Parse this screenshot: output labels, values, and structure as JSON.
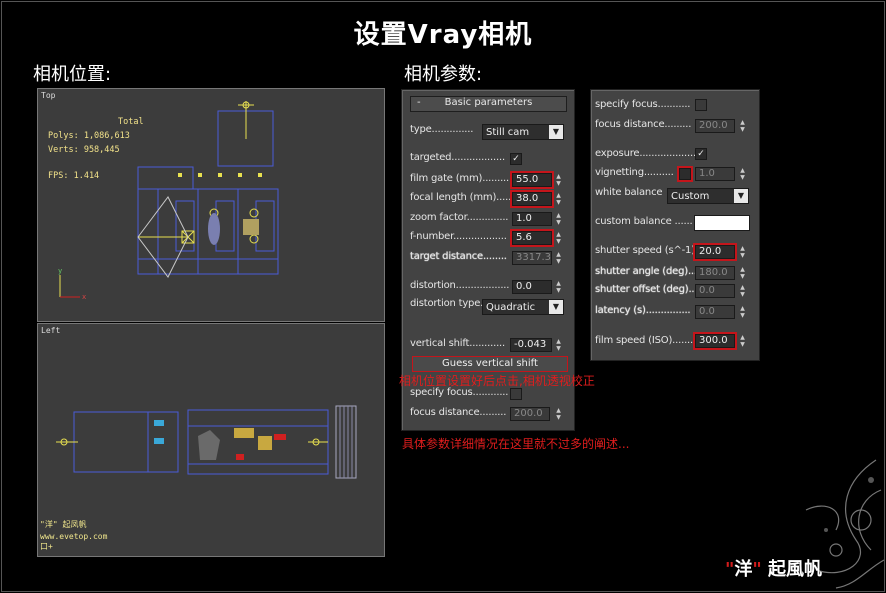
{
  "main_title": "设置Vray相机",
  "section_camera_position": "相机位置:",
  "section_camera_params": "相机参数:",
  "viewport_top": {
    "label": "Top",
    "stats": {
      "total": "Total",
      "polys": "Polys: 1,086,613",
      "verts": "Verts: 958,445",
      "fps": "FPS:  1.414"
    }
  },
  "viewport_left": {
    "label": "Left",
    "watermark_line1": "\"洋\" 起凤帆",
    "watermark_line2": "www.evetop.com",
    "watermark_line3": "口+"
  },
  "panel_basic": {
    "rollout_minus": "-",
    "rollout_title": "Basic parameters",
    "type_label": "type..............",
    "type_value": "Still cam",
    "targeted_label": "targeted..................",
    "targeted_check": "✓",
    "film_gate_label": "film gate (mm)...........",
    "film_gate_value": "55.0",
    "focal_length_label": "focal length (mm).....",
    "focal_length_value": "38.0",
    "zoom_factor_label": "zoom factor..............",
    "zoom_factor_value": "1.0",
    "f_number_label": "f-number..................",
    "f_number_value": "5.6",
    "target_distance_label": "target distance........",
    "target_distance_value": "3317.3",
    "distortion_label": "distortion..................",
    "distortion_value": "0.0",
    "distortion_type_label": "distortion type.",
    "distortion_type_value": "Quadratic",
    "vertical_shift_label": "vertical shift............",
    "vertical_shift_value": "-0.043",
    "guess_button": "Guess vertical shift",
    "specify_focus_label": "specify focus............",
    "focus_distance_label": "focus distance.........",
    "focus_distance_value": "200.0"
  },
  "panel_extra": {
    "specify_focus_label": "specify focus...........",
    "focus_distance_label": "focus distance.........",
    "focus_distance_value": "200.0",
    "exposure_label": "exposure...................",
    "exposure_check": "✓",
    "vignetting_label": "vignetting..........",
    "vignetting_value": "1.0",
    "white_balance_label": "white balance",
    "white_balance_value": "Custom",
    "custom_balance_label": "custom balance ......",
    "custom_balance_color": "#ffffff",
    "shutter_speed_label": "shutter speed (s^-1).",
    "shutter_speed_value": "20.0",
    "shutter_angle_label": "shutter angle (deg)...",
    "shutter_angle_value": "180.0",
    "shutter_offset_label": "shutter offset (deg)..",
    "shutter_offset_value": "0.0",
    "latency_label": "latency (s)...............",
    "latency_value": "0.0",
    "film_speed_label": "film speed (ISO)........",
    "film_speed_value": "300.0"
  },
  "annotation_1": "相机位置设置好后点击,相机透视校正",
  "annotation_2": "具体参数详细情况在这里就不过多的阐述...",
  "signature": {
    "quote_open": "\"",
    "name1": "洋",
    "quote_close": "\"",
    "name2": " 起風帆"
  },
  "colors": {
    "highlight_red": "#c4151b",
    "annotation_red": "#e01d1d",
    "viewport_bg": "#3c3c3c",
    "panel_bg": "#434343",
    "stats_yellow": "#f2e28a"
  }
}
